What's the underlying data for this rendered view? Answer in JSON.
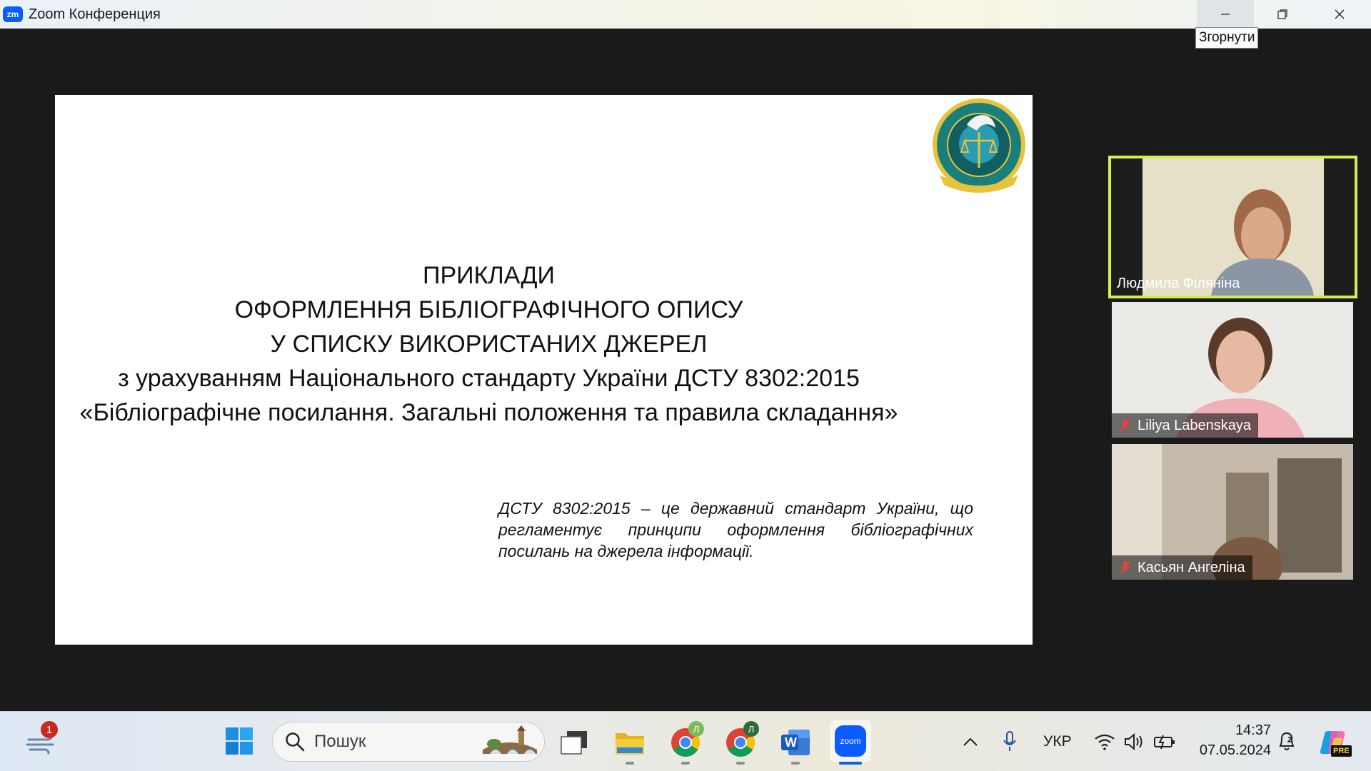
{
  "window": {
    "app_logo": "zm",
    "title": "Zoom Конференция",
    "tooltip": "Згорнути"
  },
  "slide": {
    "heading_lines": [
      "ПРИКЛАДИ",
      "ОФОРМЛЕННЯ БІБЛІОГРАФІЧНОГО ОПИСУ",
      "У СПИСКУ ВИКОРИСТАНИХ ДЖЕРЕЛ",
      "з урахуванням Національного стандарту України ДСТУ 8302:2015",
      "«Бібліографічне посилання. Загальні положення та правила складання»"
    ],
    "note_lines": [
      "ДСТУ 8302:2015 – це державний стандарт України, що",
      "регламентує принципи оформлення бібліографічних",
      "посилань на джерела інформації."
    ],
    "seal_icon": "institute-seal-icon"
  },
  "participants": [
    {
      "name": "Людмила Філяніна",
      "muted": false,
      "active": true
    },
    {
      "name": "Liliya Labenskaya",
      "muted": true,
      "active": false
    },
    {
      "name": "Касьян Ангеліна",
      "muted": true,
      "active": false
    }
  ],
  "taskbar": {
    "notification_count": "1",
    "search_placeholder": "Пошук",
    "chrome_profile_badge": "Л",
    "word_letter": "W",
    "zoom_label": "zoom",
    "language": "УКР",
    "time": "14:37",
    "date": "07.05.2024",
    "copilot_badge": "PRE"
  },
  "colors": {
    "active_speaker": "#d6f04a",
    "zoom_blue": "#0b5cff",
    "muted_red": "#e0463c"
  }
}
